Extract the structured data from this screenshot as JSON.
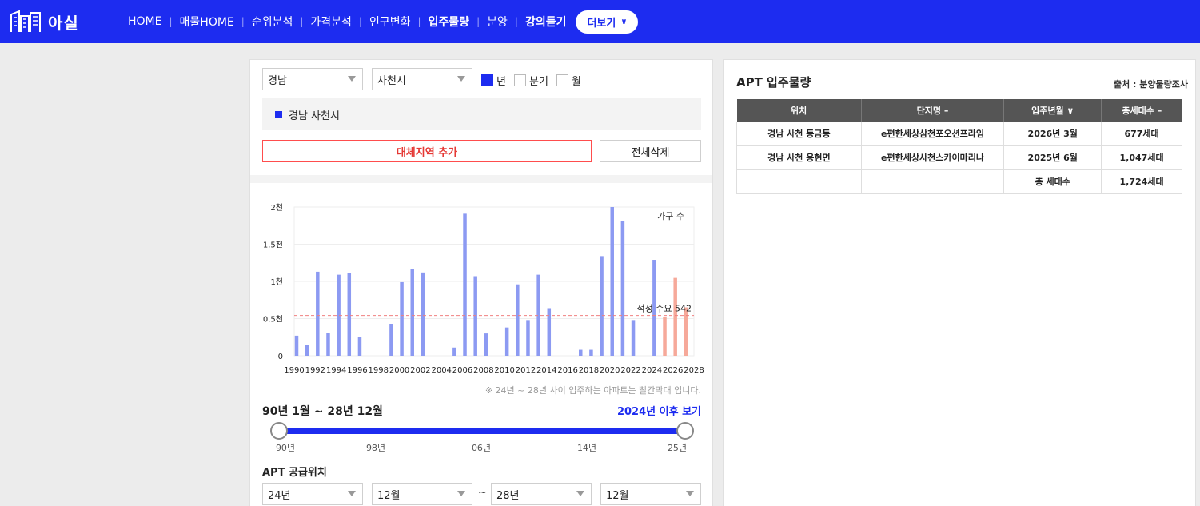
{
  "brand": {
    "name": "아실"
  },
  "nav": {
    "items": [
      {
        "label": "HOME",
        "bold": false
      },
      {
        "label": "매물HOME",
        "bold": false
      },
      {
        "label": "순위분석",
        "bold": false
      },
      {
        "label": "가격분석",
        "bold": false
      },
      {
        "label": "인구변화",
        "bold": false
      },
      {
        "label": "입주물량",
        "bold": true
      },
      {
        "label": "분양",
        "bold": false
      },
      {
        "label": "강의듣기",
        "bold": true
      }
    ],
    "more_label": "더보기"
  },
  "filters": {
    "province": "경남",
    "city": "사천시",
    "period_options": [
      {
        "label": "년",
        "checked": true
      },
      {
        "label": "분기",
        "checked": false
      },
      {
        "label": "월",
        "checked": false
      }
    ]
  },
  "selected_region": "경남 사천시",
  "buttons": {
    "add_region": "대체지역 추가",
    "clear_all": "전체삭제"
  },
  "chart_data": {
    "type": "bar",
    "legend": "가구 수",
    "x_tick_labels": [
      "1990",
      "1992",
      "1994",
      "1996",
      "1998",
      "2000",
      "2002",
      "2004",
      "2006",
      "2008",
      "2010",
      "2012",
      "2014",
      "2016",
      "2018",
      "2020",
      "2022",
      "2024",
      "2026",
      "2028"
    ],
    "y_tick_labels": [
      "0",
      "0.5천",
      "1천",
      "1.5천",
      "2천"
    ],
    "ylim": [
      0,
      2000
    ],
    "xlim": [
      1990,
      2028
    ],
    "values": [
      {
        "x": 1990,
        "y": 270
      },
      {
        "x": 1991,
        "y": 150
      },
      {
        "x": 1992,
        "y": 1130
      },
      {
        "x": 1993,
        "y": 310
      },
      {
        "x": 1994,
        "y": 1090
      },
      {
        "x": 1995,
        "y": 1110
      },
      {
        "x": 1996,
        "y": 250
      },
      {
        "x": 1999,
        "y": 430
      },
      {
        "x": 2000,
        "y": 990
      },
      {
        "x": 2001,
        "y": 1170
      },
      {
        "x": 2002,
        "y": 1120
      },
      {
        "x": 2005,
        "y": 110
      },
      {
        "x": 2006,
        "y": 1910
      },
      {
        "x": 2007,
        "y": 1070
      },
      {
        "x": 2008,
        "y": 300
      },
      {
        "x": 2010,
        "y": 380
      },
      {
        "x": 2011,
        "y": 960
      },
      {
        "x": 2012,
        "y": 480
      },
      {
        "x": 2013,
        "y": 1090
      },
      {
        "x": 2014,
        "y": 640
      },
      {
        "x": 2017,
        "y": 80
      },
      {
        "x": 2018,
        "y": 80
      },
      {
        "x": 2019,
        "y": 1340
      },
      {
        "x": 2020,
        "y": 2000
      },
      {
        "x": 2021,
        "y": 1810
      },
      {
        "x": 2022,
        "y": 480
      },
      {
        "x": 2024,
        "y": 1290
      },
      {
        "x": 2025,
        "y": 520,
        "future": true
      },
      {
        "x": 2026,
        "y": 1047,
        "future": true
      },
      {
        "x": 2027,
        "y": 650,
        "future": true
      }
    ],
    "reference_line": {
      "label": "적정 수요 542",
      "value": 542
    },
    "colors": {
      "past": "#8c9af2",
      "future": "#f6a99a",
      "reference": "#f08080"
    }
  },
  "note": "※ 24년 ~ 28년 사이 입주하는 아파트는 빨간막대 입니다.",
  "range": {
    "label": "90년 1월 ~ 28년 12월",
    "link": "2024년 이후 보기",
    "ticks": [
      "90년",
      "98년",
      "06년",
      "14년",
      "25년"
    ]
  },
  "apt_location": {
    "title": "APT 공급위치",
    "from_year": "24년",
    "from_month": "12월",
    "separator": "~",
    "to_year": "28년",
    "to_month": "12월"
  },
  "right": {
    "title": "APT 입주물량",
    "source": "출처 : 분양물량조사",
    "headers": [
      "위치",
      "단지명 –",
      "입주년월 ∨",
      "총세대수 –"
    ],
    "rows": [
      [
        "경남 사천 동금동",
        "e편한세상삼천포오션프라임",
        "2026년 3월",
        "677세대"
      ],
      [
        "경남 사천 용현면",
        "e편한세상사천스카이마리나",
        "2025년 6월",
        "1,047세대"
      ]
    ],
    "total": {
      "label": "총 세대수",
      "value": "1,724세대"
    }
  }
}
